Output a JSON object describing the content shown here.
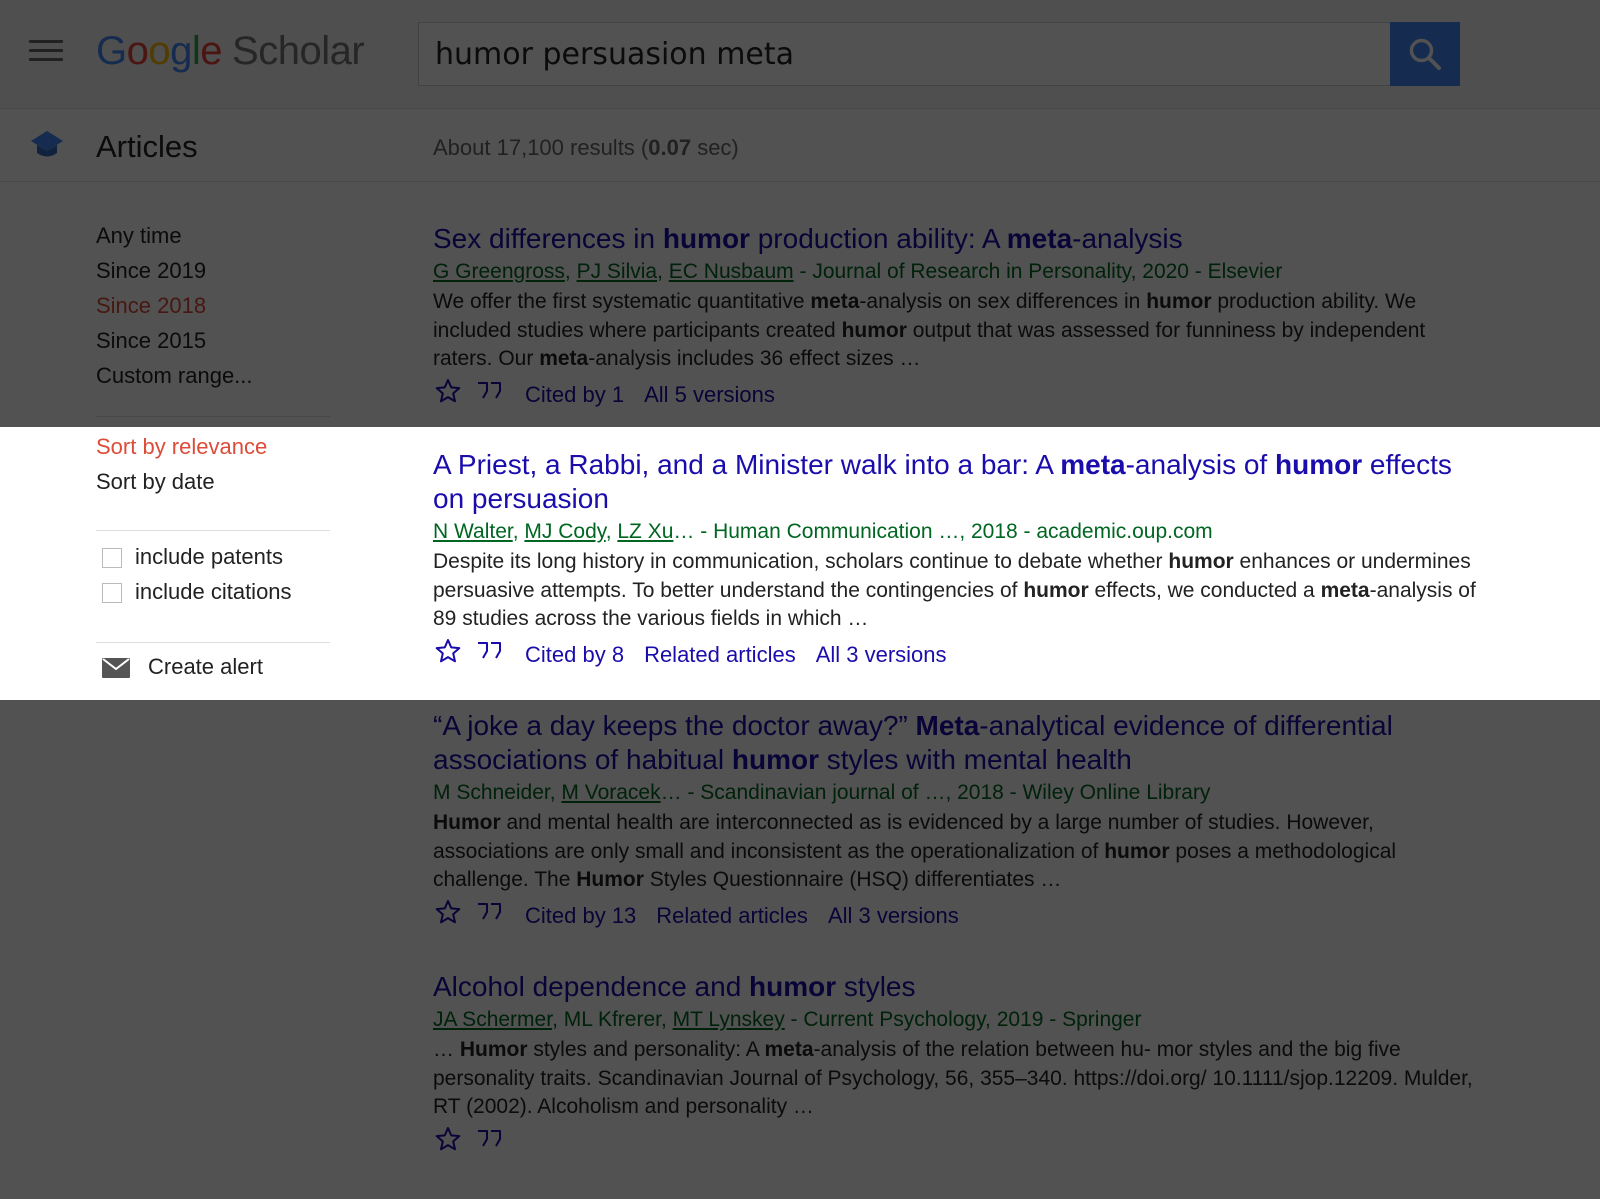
{
  "header": {
    "logo_letters": [
      "G",
      "o",
      "o",
      "g",
      "l",
      "e"
    ],
    "logo_word": "Scholar",
    "search_value": "humor persuasion meta"
  },
  "subheader": {
    "section_label": "Articles",
    "stats_prefix": "About 17,100 results (",
    "stats_time": "0.07",
    "stats_suffix": " sec)"
  },
  "sidebar": {
    "time_filters": [
      "Any time",
      "Since 2019",
      "Since 2018",
      "Since 2015",
      "Custom range..."
    ],
    "active_time_filter": "Since 2018",
    "sort_options": [
      "Sort by relevance",
      "Sort by date"
    ],
    "active_sort": "Sort by relevance",
    "include_patents": "include patents",
    "include_citations": "include citations",
    "create_alert": "Create alert"
  },
  "results": [
    {
      "title": [
        [
          "Sex differences in ",
          false
        ],
        [
          "humor",
          true
        ],
        [
          " production ability: A ",
          false
        ],
        [
          "meta",
          true
        ],
        [
          "-analysis",
          false
        ]
      ],
      "authors": [
        "G Greengross",
        "PJ Silvia",
        "EC Nusbaum"
      ],
      "source": " - Journal of Research in Personality, 2020 - Elsevier",
      "snippet": [
        [
          "We offer the first systematic quantitative ",
          false
        ],
        [
          "meta",
          true
        ],
        [
          "-analysis on sex differences in ",
          false
        ],
        [
          "humor",
          true
        ],
        [
          " production ability. We included studies where participants created ",
          false
        ],
        [
          "humor",
          true
        ],
        [
          " output that was assessed for funniness by independent raters. Our ",
          false
        ],
        [
          "meta",
          true
        ],
        [
          "-analysis includes 36 effect sizes …",
          false
        ]
      ],
      "cited_by": "Cited by 1",
      "related": "",
      "versions": "All 5 versions"
    },
    {
      "title": [
        [
          "A Priest, a Rabbi, and a Minister walk into a bar: A ",
          false
        ],
        [
          "meta",
          true
        ],
        [
          "-analysis of ",
          false
        ],
        [
          "humor",
          true
        ],
        [
          " effects on persuasion",
          false
        ]
      ],
      "authors": [
        "N Walter",
        "MJ Cody",
        "LZ Xu"
      ],
      "source": "… - Human Communication …, 2018 - academic.oup.com",
      "snippet": [
        [
          "Despite its long history in communication, scholars continue to debate whether ",
          false
        ],
        [
          "humor",
          true
        ],
        [
          " enhances or undermines persuasive attempts. To better understand the contingencies of ",
          false
        ],
        [
          "humor",
          true
        ],
        [
          " effects, we conducted a ",
          false
        ],
        [
          "meta",
          true
        ],
        [
          "-analysis of 89 studies across the various fields in which …",
          false
        ]
      ],
      "cited_by": "Cited by 8",
      "related": "Related articles",
      "versions": "All 3 versions"
    },
    {
      "title": [
        [
          "“A joke a day keeps the doctor away?” ",
          false
        ],
        [
          "Meta",
          true
        ],
        [
          "-analytical evidence of differential associations of habitual ",
          false
        ],
        [
          "humor",
          true
        ],
        [
          " styles with mental health",
          false
        ]
      ],
      "authors_plain": "M Schneider, ",
      "authors": [
        "M Voracek"
      ],
      "source": "… - Scandinavian journal of …, 2018 - Wiley Online Library",
      "snippet": [
        [
          "Humor",
          true
        ],
        [
          " and mental health are interconnected as is evidenced by a large number of studies. However, associations are only small and inconsistent as the operationalization of ",
          false
        ],
        [
          "humor",
          true
        ],
        [
          " poses a methodological challenge. The ",
          false
        ],
        [
          "Humor",
          true
        ],
        [
          " Styles Questionnaire (HSQ) differentiates …",
          false
        ]
      ],
      "cited_by": "Cited by 13",
      "related": "Related articles",
      "versions": "All 3 versions"
    },
    {
      "title": [
        [
          "Alcohol dependence and ",
          false
        ],
        [
          "humor",
          true
        ],
        [
          " styles",
          false
        ]
      ],
      "authors": [
        "JA Schermer",
        "ML Kfrerer",
        "MT Lynskey"
      ],
      "plain_author_index": 1,
      "source": " - Current Psychology, 2019 - Springer",
      "snippet": [
        [
          "… ",
          false
        ],
        [
          "Humor",
          true
        ],
        [
          " styles and personality: A ",
          false
        ],
        [
          "meta",
          true
        ],
        [
          "-analysis of the relation between hu- mor styles and the big five personality traits. Scandinavian Journal of Psychology, 56, 355–340. https://doi.org/ 10.1111/sjop.12209. Mulder, RT (2002). Alcoholism and personality …",
          false
        ]
      ],
      "cited_by": "",
      "related": "",
      "versions": ""
    }
  ],
  "colors": {
    "link": "#1a0dab",
    "meta_green": "#006621",
    "active_red": "#dd4b39",
    "search_blue": "#4285f4"
  }
}
